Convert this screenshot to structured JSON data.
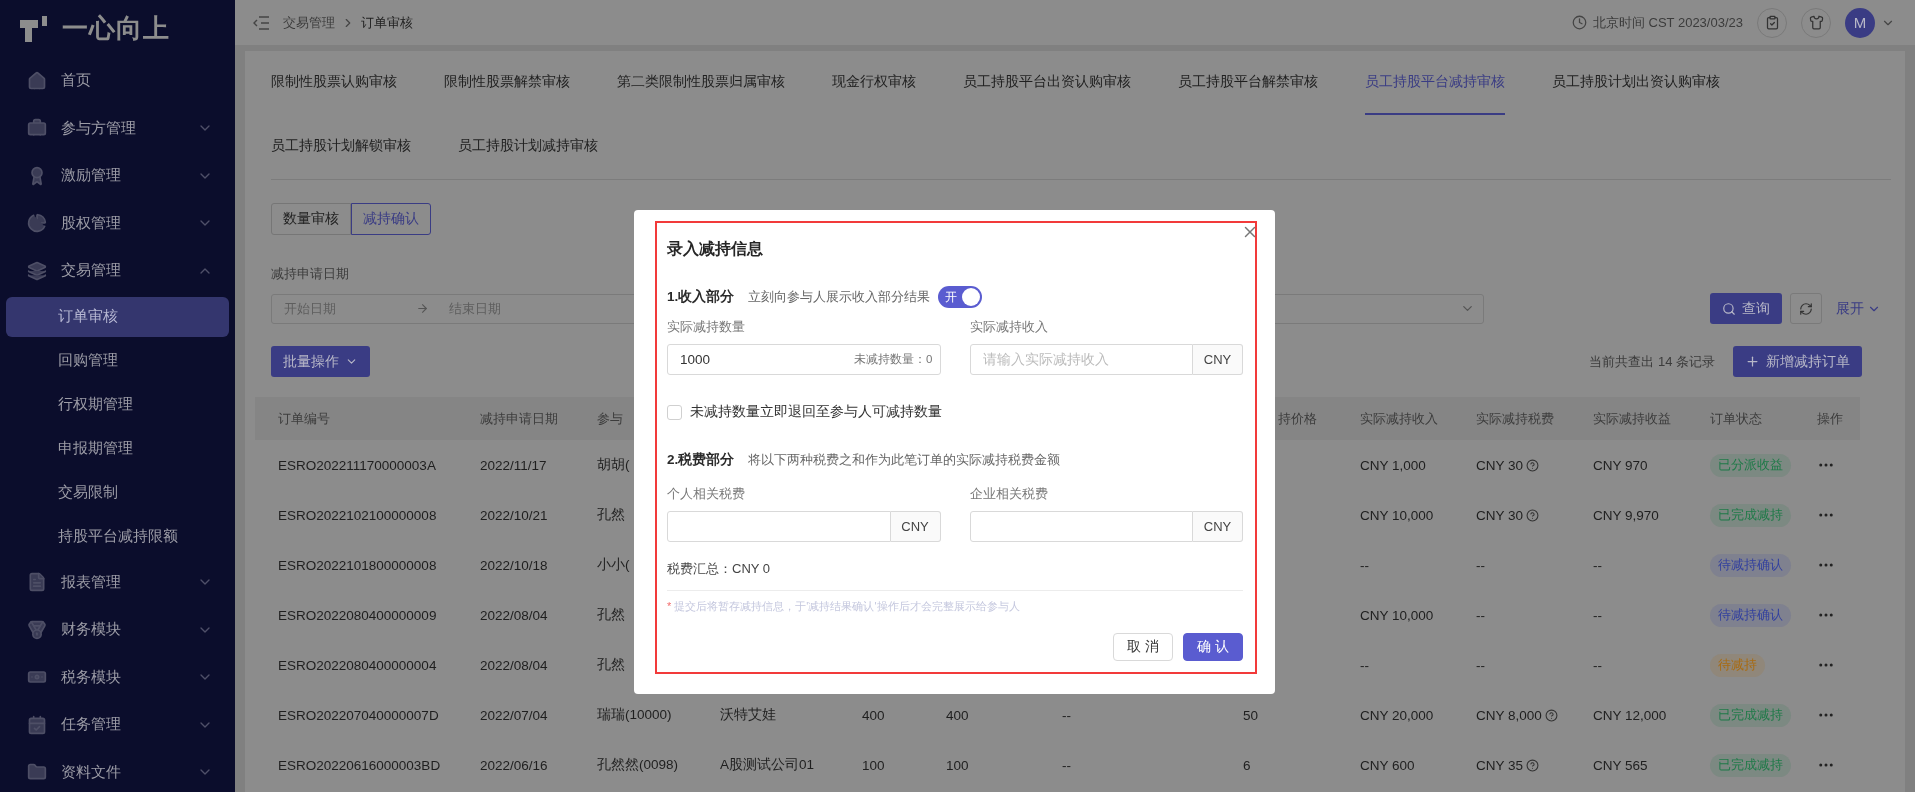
{
  "sidebar": {
    "logo": "一心向上",
    "items": [
      {
        "label": "首页",
        "kind": "link"
      },
      {
        "label": "参与方管理",
        "kind": "group",
        "expanded": false
      },
      {
        "label": "激励管理",
        "kind": "group",
        "expanded": false
      },
      {
        "label": "股权管理",
        "kind": "group",
        "expanded": false
      },
      {
        "label": "交易管理",
        "kind": "group",
        "expanded": true,
        "children": [
          {
            "label": "订单审核",
            "selected": true
          },
          {
            "label": "回购管理",
            "selected": false
          },
          {
            "label": "行权期管理",
            "selected": false
          },
          {
            "label": "申报期管理",
            "selected": false
          },
          {
            "label": "交易限制",
            "selected": false
          },
          {
            "label": "持股平台减持限额",
            "selected": false
          }
        ]
      },
      {
        "label": "报表管理",
        "kind": "group",
        "expanded": false
      },
      {
        "label": "财务模块",
        "kind": "group",
        "expanded": false
      },
      {
        "label": "税务模块",
        "kind": "group",
        "expanded": false
      },
      {
        "label": "任务管理",
        "kind": "group",
        "expanded": false
      },
      {
        "label": "资料文件",
        "kind": "group",
        "expanded": false
      }
    ]
  },
  "header": {
    "breadcrumb": [
      "交易管理",
      "订单审核"
    ],
    "time": "北京时间 CST 2023/03/23",
    "avatar": "M"
  },
  "tabs": [
    {
      "label": "限制性股票认购审核",
      "selected": false
    },
    {
      "label": "限制性股票解禁审核",
      "selected": false
    },
    {
      "label": "第二类限制性股票归属审核",
      "selected": false
    },
    {
      "label": "现金行权审核",
      "selected": false
    },
    {
      "label": "员工持股平台出资认购审核",
      "selected": false
    },
    {
      "label": "员工持股平台解禁审核",
      "selected": false
    },
    {
      "label": "员工持股平台减持审核",
      "selected": true
    },
    {
      "label": "员工持股计划出资认购审核",
      "selected": false
    },
    {
      "label": "员工持股计划解锁审核",
      "selected": false
    },
    {
      "label": "员工持股计划减持审核",
      "selected": false
    }
  ],
  "segments": [
    {
      "label": "数量审核",
      "selected": false
    },
    {
      "label": "减持确认",
      "selected": true
    }
  ],
  "filters": {
    "date_label": "减持申请日期",
    "start_placeholder": "开始日期",
    "end_placeholder": "结束日期",
    "search_button": "查询",
    "expand_button": "展开"
  },
  "toolbar": {
    "batch_button": "批量操作",
    "record_count": "当前共查出 14 条记录",
    "add_button": "新增减持订单"
  },
  "table": {
    "columns": [
      "订单编号",
      "减持申请日期",
      "参与",
      null,
      null,
      null,
      null,
      "持价格",
      "实际减持收入",
      "实际减持税费",
      "实际减持收益",
      "订单状态",
      "操作"
    ],
    "rows": [
      {
        "cells": [
          "ESRO202211170000003A",
          "2022/11/17",
          "胡胡(",
          null,
          null,
          null,
          null,
          null,
          "CNY 1,000",
          "CNY 30",
          "CNY 970"
        ],
        "tax_hint": true,
        "status": {
          "label": "已分派收益",
          "color": "#1f7a48"
        }
      },
      {
        "cells": [
          "ESRO2022102100000008",
          "2022/10/21",
          "孔然",
          null,
          null,
          null,
          null,
          null,
          "CNY 10,000",
          "CNY 30",
          "CNY 9,970"
        ],
        "tax_hint": true,
        "status": {
          "label": "已完成减持",
          "color": "#1f7a48"
        }
      },
      {
        "cells": [
          "ESRO2022101800000008",
          "2022/10/18",
          "小小(",
          null,
          null,
          null,
          null,
          null,
          "--",
          "--",
          "--"
        ],
        "tax_hint": false,
        "status": {
          "label": "待减持确认",
          "color": "#33419e"
        }
      },
      {
        "cells": [
          "ESRO2022080400000009",
          "2022/08/04",
          "孔然",
          null,
          null,
          null,
          null,
          null,
          "CNY 10,000",
          "--",
          "--"
        ],
        "tax_hint": false,
        "status": {
          "label": "待减持确认",
          "color": "#33419e"
        }
      },
      {
        "cells": [
          "ESRO2022080400000004",
          "2022/08/04",
          "孔然",
          null,
          null,
          null,
          null,
          null,
          "--",
          "--",
          "--"
        ],
        "tax_hint": false,
        "status": {
          "label": "待减持",
          "color": "#a86b12"
        }
      },
      {
        "cells": [
          "ESRO202207040000007D",
          "2022/07/04",
          "瑞瑞(10000)",
          "沃特艾娃",
          "400",
          "400",
          "--",
          "50",
          "CNY 20,000",
          "CNY 8,000",
          "CNY 12,000"
        ],
        "tax_hint": true,
        "status": {
          "label": "已完成减持",
          "color": "#1f7a48"
        }
      },
      {
        "cells": [
          "ESRO20220616000003BD",
          "2022/06/16",
          "孔然然(0098)",
          "A股测试公司01",
          "100",
          "100",
          "--",
          "6",
          "CNY 600",
          "CNY 35",
          "CNY 565"
        ],
        "tax_hint": true,
        "status": {
          "label": "已完成减持",
          "color": "#1f7a48"
        }
      }
    ]
  },
  "dialog": {
    "title": "录入减持信息",
    "income_section": {
      "heading": "1.收入部分",
      "description": "立刻向参与人展示收入部分结果",
      "switch": {
        "on": true,
        "label": "开"
      }
    },
    "income_fields": [
      {
        "label": "实际减持数量",
        "value": "1000",
        "suffix_text": "未减持数量：0"
      },
      {
        "label": "实际减持收入",
        "placeholder": "请输入实际减持收入",
        "addon": "CNY"
      }
    ],
    "return_checkbox": {
      "label": "未减持数量立即退回至参与人可减持数量",
      "checked": false
    },
    "tax_section": {
      "heading": "2.税费部分",
      "description": "将以下两种税费之和作为此笔订单的实际减持税费金额"
    },
    "tax_fields": [
      {
        "label": "个人相关税费",
        "addon": "CNY"
      },
      {
        "label": "企业相关税费",
        "addon": "CNY"
      }
    ],
    "tax_total": "税费汇总：CNY 0",
    "note": {
      "mark": "*",
      "text": "提交后将暂存减持信息，于'减持结果确认'操作后才会完整展示给参与人"
    },
    "buttons": [
      {
        "label": "取 消",
        "kind": "default"
      },
      {
        "label": "确 认",
        "kind": "primary"
      }
    ]
  }
}
